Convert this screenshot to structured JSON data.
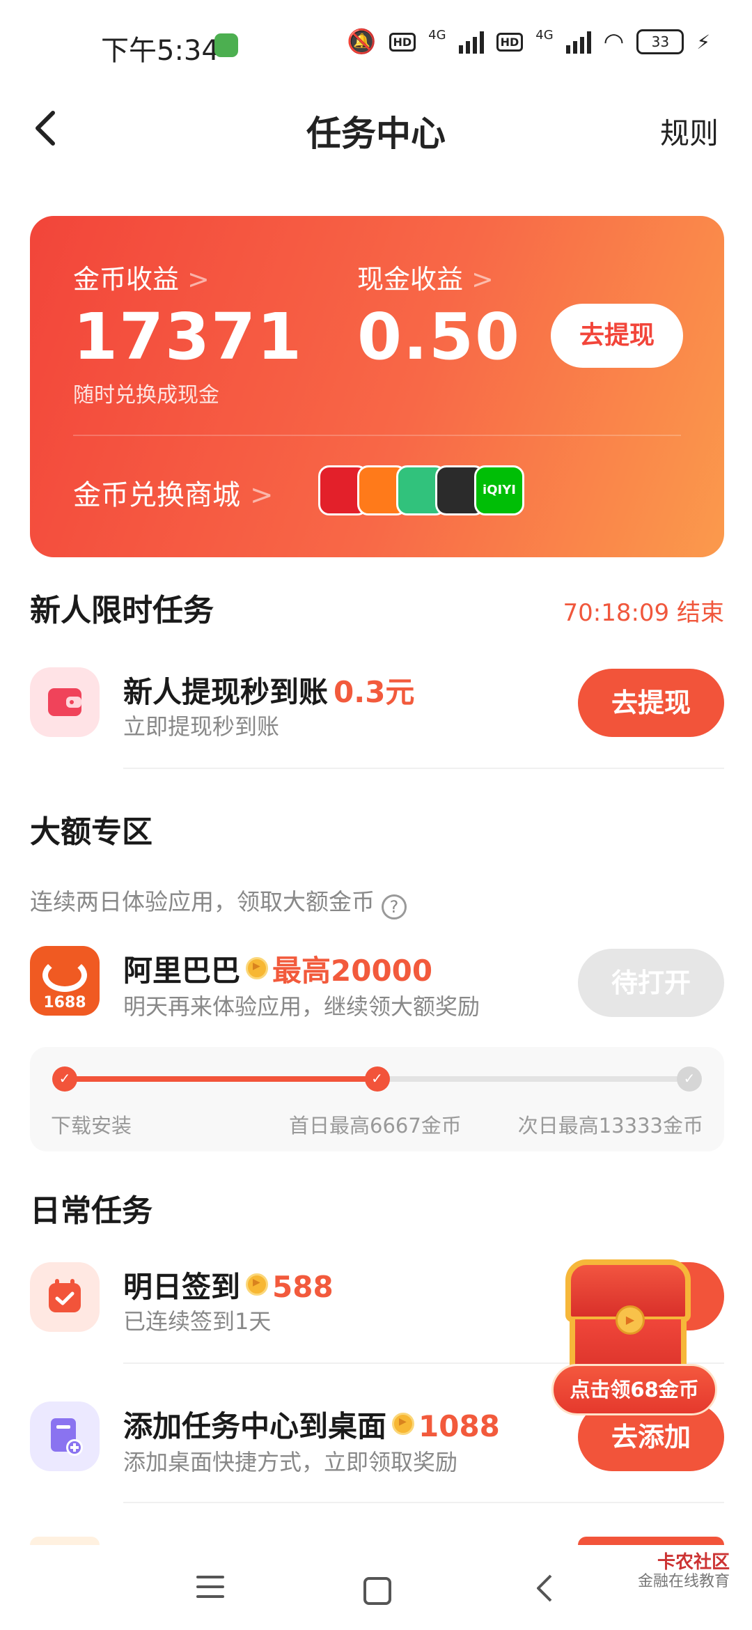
{
  "status_bar": {
    "time": "下午5:34",
    "network_1": "4G",
    "network_2": "4G",
    "hd_label": "HD",
    "battery": "33"
  },
  "header": {
    "back_icon": "chevron-left-icon",
    "title": "任务中心",
    "rules_label": "规则"
  },
  "earnings_card": {
    "coin_label": "金币收益",
    "coin_value": "17371",
    "coin_sub": "随时兑换成现金",
    "cash_label": "现金收益",
    "cash_value": "0.50",
    "withdraw_label": "去提现",
    "mall_label": "金币兑换商城",
    "chevron": ">",
    "gradient_start": "#f2453a",
    "gradient_end": "#fb9a4c",
    "apps": [
      {
        "name": "netease-music-icon",
        "glyph": "",
        "color": "#e3202a"
      },
      {
        "name": "mango-tv-icon",
        "glyph": "",
        "color": "#ff7a1a"
      },
      {
        "name": "qq-music-icon",
        "glyph": "",
        "color": "#31c27c"
      },
      {
        "name": "kugou-icon",
        "glyph": "",
        "color": "#2b2b2b"
      },
      {
        "name": "iqiyi-icon",
        "glyph": "iQIYI",
        "color": "#00be06"
      }
    ]
  },
  "newbie_section": {
    "title": "新人限时任务",
    "countdown": "70:18:09 结束",
    "task": {
      "title": "新人提现秒到账",
      "reward": "0.3元",
      "desc": "立即提现秒到账",
      "button": "去提现"
    }
  },
  "big_section": {
    "title": "大额专区",
    "hint": "连续两日体验应用，领取大额金币",
    "help": "?",
    "app": {
      "icon_text": "1688",
      "title": "阿里巴巴",
      "reward": "最高20000",
      "desc": "明天再来体验应用，继续领大额奖励",
      "button": "待打开"
    },
    "progress": {
      "steps": [
        "下载安装",
        "首日最高6667金币",
        "次日最高13333金币"
      ],
      "completed": 2,
      "total": 3
    }
  },
  "daily_section": {
    "title": "日常任务",
    "tasks": [
      {
        "title": "明日签到",
        "reward": "588",
        "desc": "已连续签到1天"
      },
      {
        "title": "添加任务中心到桌面",
        "reward": "1088",
        "desc": "添加桌面快捷方式，立即领取奖励",
        "button": "去添加"
      }
    ]
  },
  "chest": {
    "banner": "点击领68金币"
  },
  "watermark": {
    "brand": "卡农社区",
    "slogan": "金融在线教育"
  },
  "colors": {
    "accent": "#f2543a",
    "disabled": "#e6e6e6",
    "muted_text": "#888888"
  }
}
